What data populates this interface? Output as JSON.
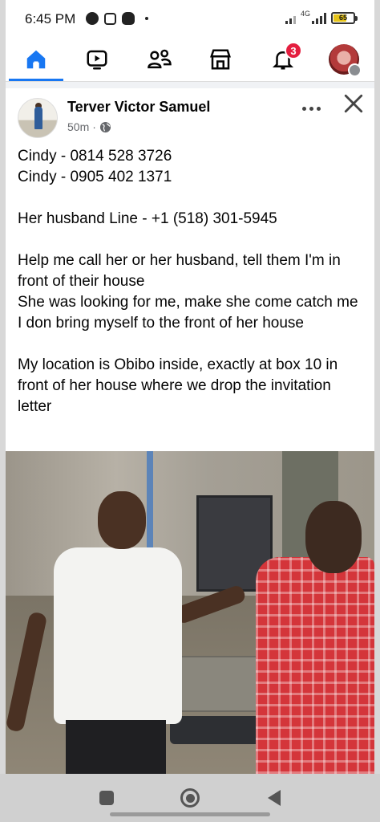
{
  "status_bar": {
    "time": "6:45 PM",
    "network": "4G",
    "battery": "65",
    "battery_level": 0.65
  },
  "nav": {
    "items": [
      {
        "name": "home",
        "icon": "home-icon"
      },
      {
        "name": "watch",
        "icon": "video-icon"
      },
      {
        "name": "friends",
        "icon": "friends-icon"
      },
      {
        "name": "marketplace",
        "icon": "marketplace-icon"
      },
      {
        "name": "notifications",
        "icon": "bell-icon"
      },
      {
        "name": "profile-menu",
        "icon": "avatar"
      }
    ],
    "notification_count": "3",
    "active_color": "#1877f2",
    "inactive_color": "#050505",
    "badge_color": "#e41e3f"
  },
  "post": {
    "author": "Terver Victor Samuel",
    "time": "50m",
    "privacy_icon": "globe-icon",
    "lines": [
      "Cindy - 0814 528 3726",
      "Cindy - 0905 402 1371",
      "",
      "Her husband Line - +1 (518) 301-5945",
      "",
      "Help me call her or her husband, tell them I'm in front of their house",
      "She was looking for me, make she come catch me",
      "I don bring myself to the front of her house",
      "",
      "My location is Obibo inside, exactly at box 10 in front of her house where we drop the invitation letter"
    ]
  }
}
